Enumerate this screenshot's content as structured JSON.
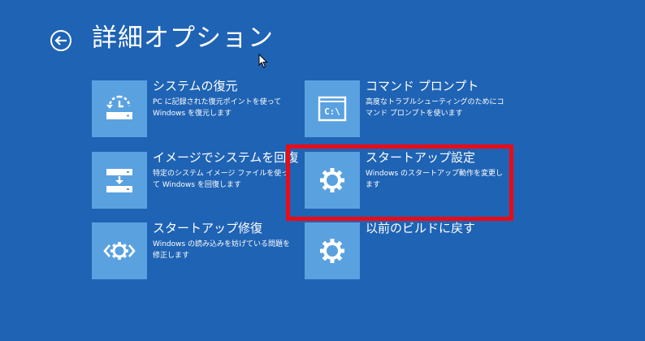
{
  "header": {
    "title": "詳細オプション",
    "back_icon": "back-arrow-circle-icon"
  },
  "colors": {
    "background": "#1f63b4",
    "tile": "#5aa1e0",
    "highlight": "#ee0a14"
  },
  "options": {
    "system_restore": {
      "title": "システムの復元",
      "desc": "PC に記録された復元ポイントを使って Windows を復元します",
      "icon": "system-restore-icon"
    },
    "image_recovery": {
      "title": "イメージでシステムを回復",
      "desc": "特定のシステム イメージ ファイルを使って Windows を回復します",
      "icon": "system-image-recovery-icon"
    },
    "startup_repair": {
      "title": "スタートアップ修復",
      "desc": "Windows の読み込みを妨げている問題を修正します",
      "icon": "startup-repair-icon"
    },
    "command_prompt": {
      "title": "コマンド プロンプト",
      "desc": "高度なトラブルシューティングのためにコマンド プロンプトを使います",
      "icon": "command-prompt-icon",
      "icon_text": "C:\\"
    },
    "startup_settings": {
      "title": "スタートアップ設定",
      "desc": "Windows のスタートアップ動作を変更します",
      "icon": "gear-icon"
    },
    "previous_build": {
      "title": "以前のビルドに戻す",
      "desc": "",
      "icon": "gear-icon"
    }
  }
}
